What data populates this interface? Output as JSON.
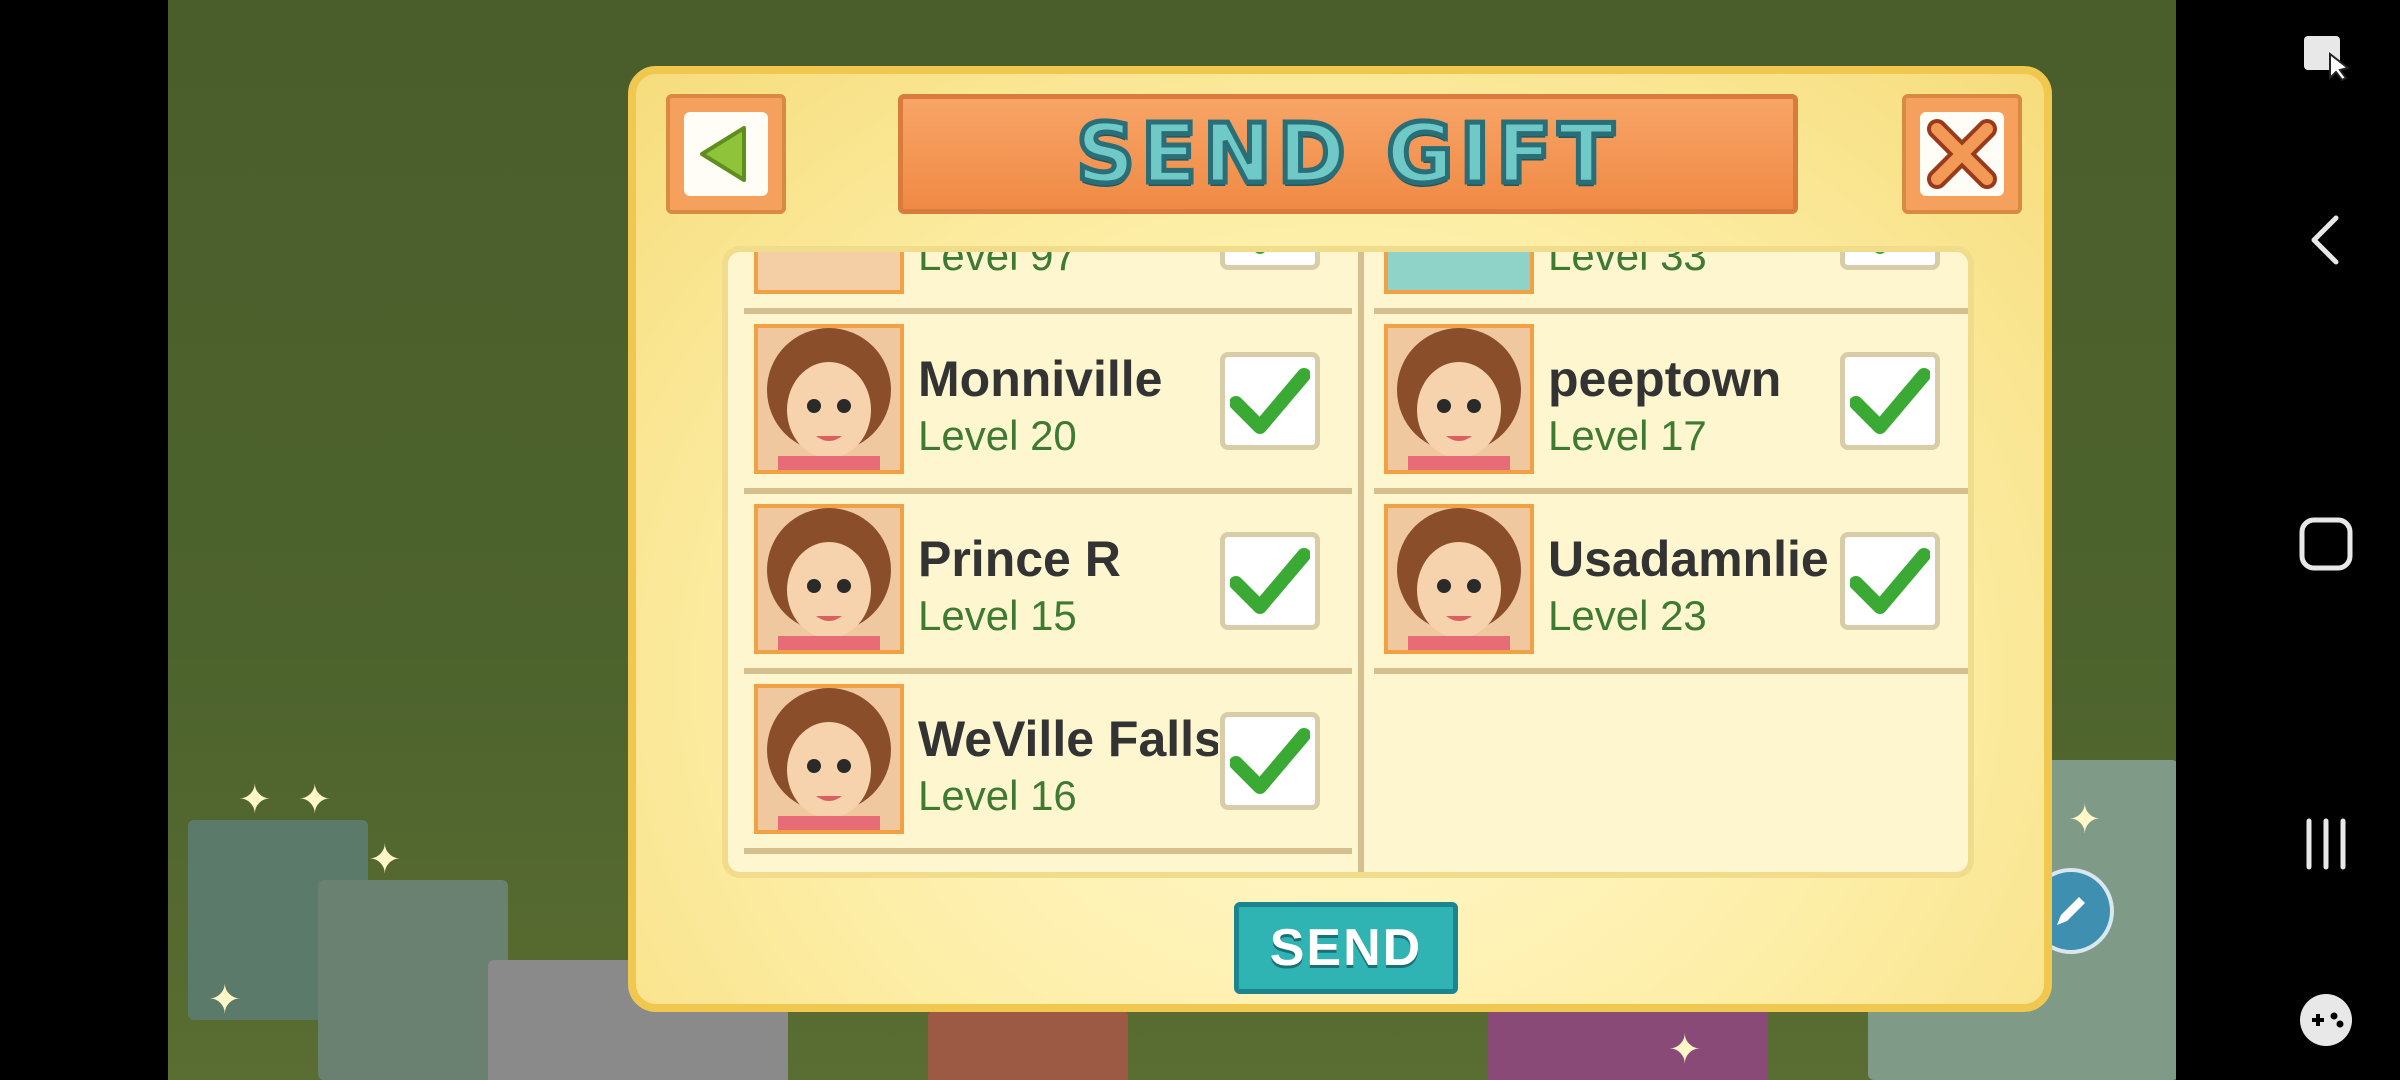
{
  "dialog": {
    "title": "SEND GIFT",
    "send_label": "SEND",
    "left_column": [
      {
        "name": "",
        "level": "Level 97",
        "partial": true
      },
      {
        "name": "Monniville",
        "level": "Level 20",
        "checked": true
      },
      {
        "name": "Prince R",
        "level": "Level 15",
        "checked": true
      },
      {
        "name": "WeVille Falls",
        "level": "Level 16",
        "checked": true
      }
    ],
    "right_column": [
      {
        "name": "",
        "level": "Level 33",
        "partial": true
      },
      {
        "name": "peeptown",
        "level": "Level 17",
        "checked": true
      },
      {
        "name": "Usadamnlie",
        "level": "Level 23",
        "checked": true
      }
    ]
  },
  "icons": {
    "back": "left-triangle-icon",
    "close": "x-icon",
    "check": "checkmark-icon"
  },
  "colors": {
    "title_bg": "#f08a45",
    "send_bg": "#2fb3b3",
    "check_green": "#3aaa35",
    "level_text": "#3f7a32"
  }
}
